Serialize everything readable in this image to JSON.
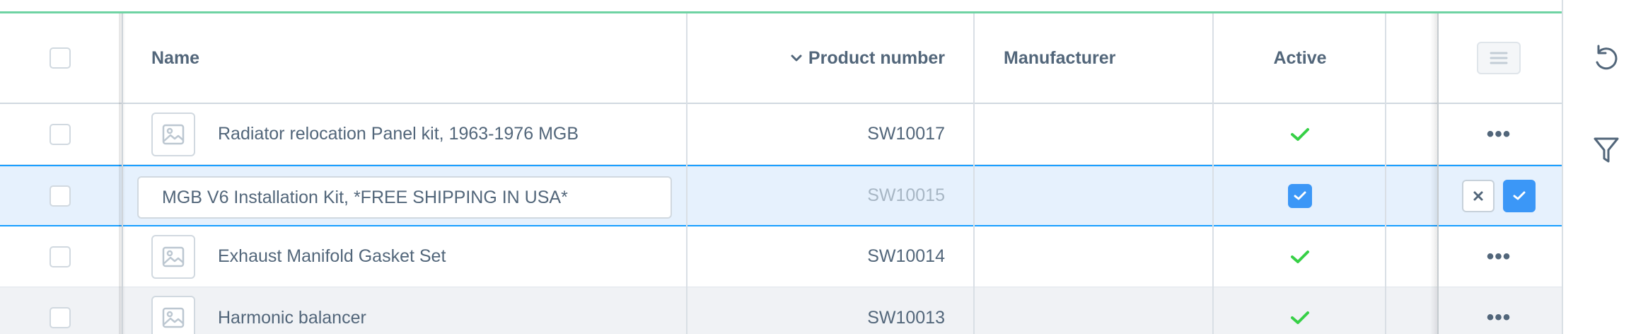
{
  "table": {
    "columns": {
      "name": "Name",
      "product_number": "Product number",
      "manufacturer": "Manufacturer",
      "active": "Active"
    },
    "sorted_column": "product_number",
    "sort_direction": "descending",
    "rows": [
      {
        "name": "Radiator relocation Panel kit, 1963-1976 MGB",
        "product_number": "SW10017",
        "manufacturer": "",
        "active": true,
        "state": "normal"
      },
      {
        "name": "MGB V6 Installation Kit, *FREE SHIPPING IN USA*",
        "product_number": "SW10015",
        "manufacturer": "",
        "active": true,
        "state": "editing"
      },
      {
        "name": "Exhaust Manifold Gasket Set",
        "product_number": "SW10014",
        "manufacturer": "",
        "active": true,
        "state": "normal"
      },
      {
        "name": "Harmonic balancer",
        "product_number": "SW10013",
        "manufacturer": "",
        "active": true,
        "state": "normal"
      }
    ],
    "row_actions_label": "•••"
  },
  "icons": {
    "select_all": "checkbox-icon",
    "sort": "chevron-down-icon",
    "thumbnail": "image-placeholder-icon",
    "active": "checkmark-icon",
    "column_settings": "menu-icon",
    "cancel_edit": "close-icon",
    "save_edit": "checkmark-icon",
    "reset": "undo-icon",
    "filter": "filter-icon"
  },
  "colors": {
    "accent_top": "#6fd3a3",
    "primary": "#189eff",
    "active_check": "#37d046",
    "editing_row_bg": "#e6f1fd",
    "text": "#52667a",
    "muted_text": "#a7b6c4"
  }
}
